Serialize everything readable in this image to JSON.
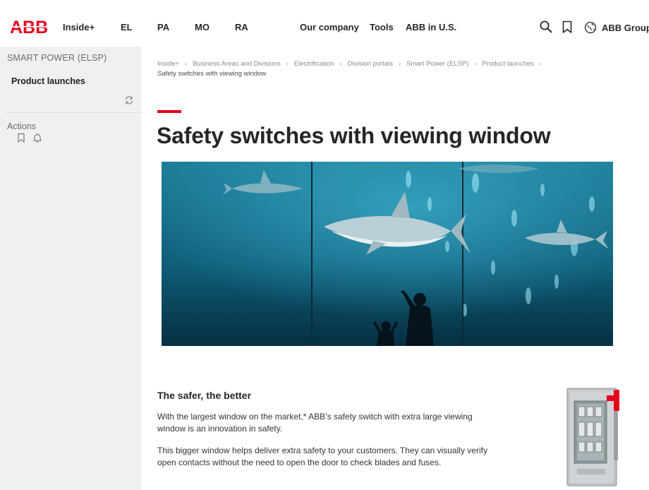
{
  "header": {
    "logo_text": "ABB",
    "nav": [
      "Inside+",
      "EL",
      "PA",
      "MO",
      "RA",
      "Our company",
      "Tools",
      "ABB in U.S."
    ],
    "group_label": "ABB Group",
    "brand_color": "#e4001b",
    "icons": [
      "search-icon",
      "bookmark-icon",
      "globe-icon"
    ]
  },
  "sidebar": {
    "section_title": "SMART POWER (ELSP)",
    "item": "Product launches",
    "actions_label": "Actions",
    "icons": [
      "refresh-icon",
      "bookmark-icon",
      "bell-icon"
    ]
  },
  "breadcrumb": {
    "items": [
      "Inside+",
      "Business Areas and Divisions",
      "Electrification",
      "Division portals",
      "Smart Power (ELSP)",
      "Product launches"
    ],
    "current": "Safety switches with viewing window"
  },
  "page": {
    "title": "Safety switches with viewing window"
  },
  "content": {
    "heading": "The safer, the better",
    "p1": "With the largest window on the market,* ABB’s safety switch with extra large viewing window is an innovation in safety.",
    "p2": "This bigger window helps deliver extra safety to your customers. They can visually verify open contacts without the need to open the door to check blades and fuses."
  }
}
